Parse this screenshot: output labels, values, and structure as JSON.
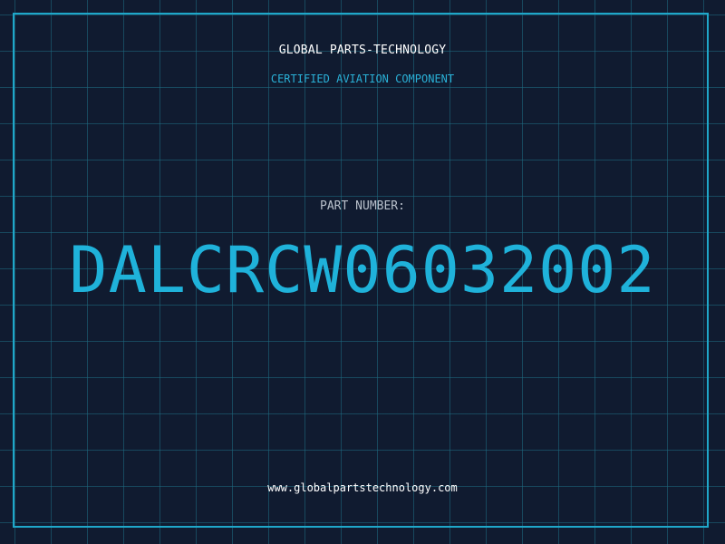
{
  "label": {
    "company": "GLOBAL PARTS-TECHNOLOGY",
    "tagline": "CERTIFIED AVIATION COMPONENT",
    "part_number_label": "PART NUMBER:",
    "part_number": "DALCRCW06032002",
    "website": "www.globalpartstechnology.com"
  },
  "colors": {
    "background": "#101b30",
    "grid": "#1e6e82",
    "accent": "#1fb2da",
    "frame": "#1fa7c9"
  }
}
